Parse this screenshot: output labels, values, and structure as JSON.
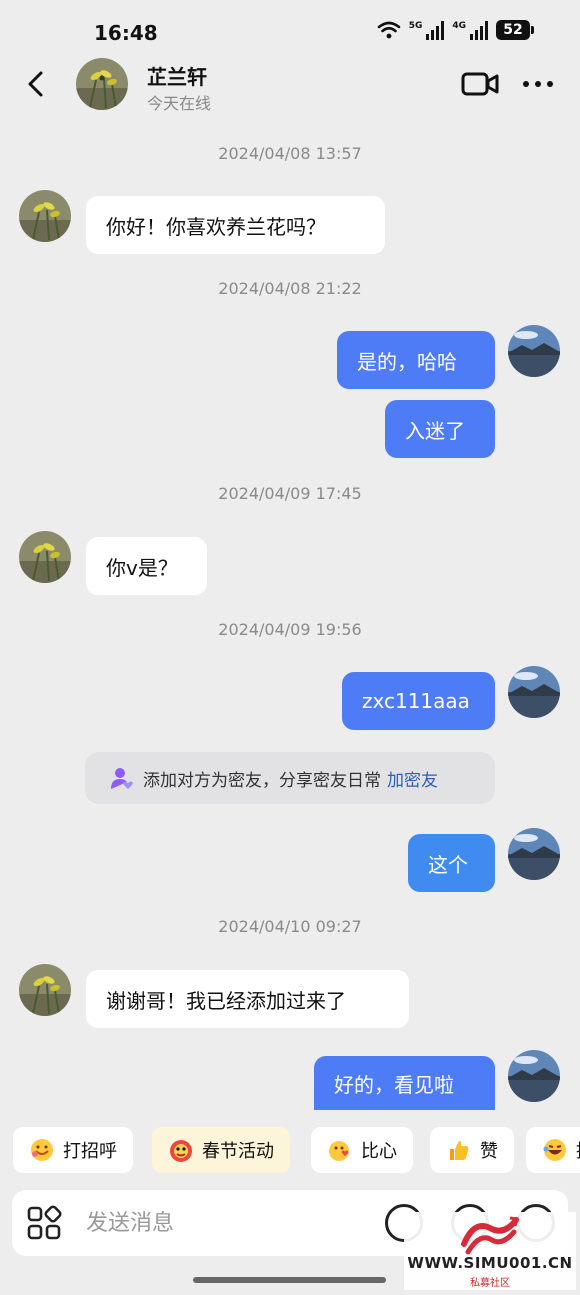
{
  "status_bar": {
    "time": "16:48",
    "net_5g": "5G",
    "net_4g": "4G",
    "battery": "52"
  },
  "header": {
    "contact_name": "芷兰轩",
    "contact_status": "今天在线"
  },
  "messages": [
    {
      "type": "timestamp",
      "text": "2024/04/08 13:57"
    },
    {
      "type": "incoming",
      "text": "你好！你喜欢养兰花吗？"
    },
    {
      "type": "timestamp",
      "text": "2024/04/08 21:22"
    },
    {
      "type": "outgoing",
      "text": "是的，哈哈"
    },
    {
      "type": "outgoing",
      "text": "入迷了"
    },
    {
      "type": "timestamp",
      "text": "2024/04/09 17:45"
    },
    {
      "type": "incoming",
      "text": "你v是？"
    },
    {
      "type": "timestamp",
      "text": "2024/04/09 19:56"
    },
    {
      "type": "outgoing",
      "text": "zxc111aaa"
    },
    {
      "type": "system",
      "text": "添加对方为密友，分享密友日常",
      "link": "加密友"
    },
    {
      "type": "outgoing",
      "text": "这个"
    },
    {
      "type": "timestamp",
      "text": "2024/04/10 09:27"
    },
    {
      "type": "incoming",
      "text": "谢谢哥！我已经添加过来了"
    },
    {
      "type": "outgoing",
      "text": "好的，看见啦"
    }
  ],
  "quick_replies": [
    {
      "label": "打招呼",
      "icon": "smile-face-icon"
    },
    {
      "label": "春节活动",
      "icon": "lion-dance-icon"
    },
    {
      "label": "比心",
      "icon": "heart-hands-icon"
    },
    {
      "label": "赞",
      "icon": "thumbs-up-icon"
    },
    {
      "label": "搞",
      "icon": "laughing-face-icon"
    }
  ],
  "input": {
    "placeholder": "发送消息"
  },
  "watermark": {
    "site": "WWW.SIMU001.CN",
    "sub": "私募社区"
  },
  "colors": {
    "outgoing_bubble": "#4d7cf6",
    "link": "#2d5fb5",
    "background": "#ededed"
  }
}
